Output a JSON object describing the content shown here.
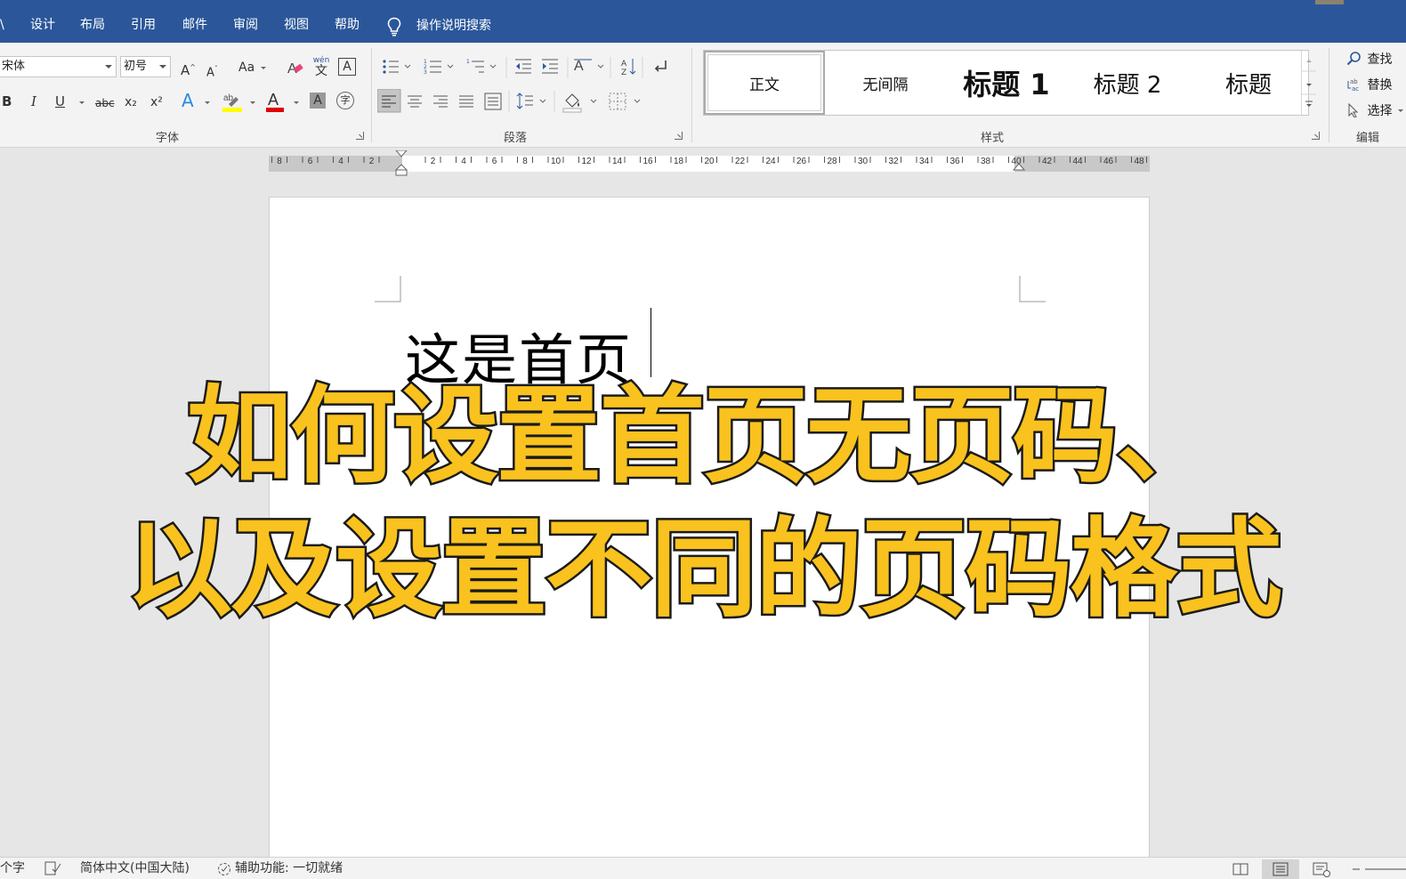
{
  "menubar": {
    "cut_tab": "\\",
    "tabs": [
      "设计",
      "布局",
      "引用",
      "邮件",
      "审阅",
      "视图",
      "帮助"
    ],
    "tell_me": "操作说明搜索"
  },
  "ribbon": {
    "font": {
      "name": "宋体",
      "size": "初号",
      "label": "字体",
      "bold": "B",
      "italic": "I",
      "underline": "U",
      "strike": "abc",
      "subscript": "x₂",
      "superscript": "x²",
      "change_case": "Aa",
      "grow": "A",
      "shrink": "A",
      "phonetic_top": "wén",
      "phonetic_bottom": "文",
      "border_char": "A",
      "effects": "A",
      "font_color": "A",
      "shading": "A",
      "enclose": "字"
    },
    "paragraph": {
      "label": "段落"
    },
    "styles": {
      "label": "样式",
      "items": [
        "正文",
        "无间隔",
        "标题 1",
        "标题 2",
        "标题"
      ]
    },
    "editing": {
      "label": "编辑",
      "find": "查找",
      "replace": "替换",
      "select": "选择"
    }
  },
  "ruler": {
    "labels": [
      "8",
      "6",
      "4",
      "2",
      "2",
      "4",
      "6",
      "8",
      "10",
      "12",
      "14",
      "16",
      "18",
      "20",
      "22",
      "24",
      "26",
      "28",
      "30",
      "32",
      "34",
      "36",
      "38",
      "40",
      "42",
      "44",
      "46",
      "48"
    ]
  },
  "document": {
    "text": "这是首页"
  },
  "overlay": {
    "line1": "如何设置首页无页码、",
    "line2": "以及设置不同的页码格式"
  },
  "statusbar": {
    "word_count": "个字",
    "language": "简体中文(中国大陆)",
    "accessibility": "辅助功能: 一切就绪"
  },
  "colors": {
    "title_bar": "#2b579a",
    "overlay_fill": "#f9c21e",
    "overlay_stroke": "#1b1b1b",
    "highlight_yellow": "#ffff00",
    "font_color_red": "#e00000"
  }
}
